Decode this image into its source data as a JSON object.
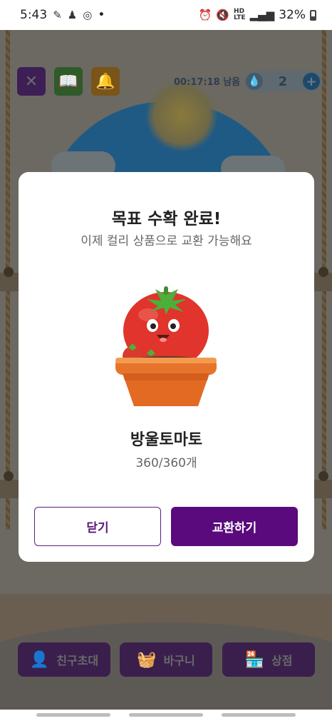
{
  "status": {
    "time": "5:43",
    "dot": "•",
    "network": "HD\nLTE",
    "battery": "32%"
  },
  "game": {
    "timer": "00:17:18 남음",
    "water_count": "2",
    "bottom_buttons": {
      "invite": "친구초대",
      "basket": "바구니",
      "shop": "상점"
    }
  },
  "modal": {
    "title": "목표 수확 완료!",
    "subtitle": "이제 컬리 상품으로 교환 가능해요",
    "item_name": "방울토마토",
    "item_count": "360/360개",
    "close_label": "닫기",
    "exchange_label": "교환하기"
  },
  "colors": {
    "primary": "#5b0a7e",
    "overlay": "#6c6962",
    "tomato": "#e0342c",
    "pot": "#e7742c"
  },
  "icons": [
    "close-icon",
    "book-icon",
    "bell-icon",
    "water-drop-icon",
    "plus-icon",
    "add-friend-icon",
    "basket-icon",
    "shop-icon",
    "tomato-plant-image"
  ]
}
